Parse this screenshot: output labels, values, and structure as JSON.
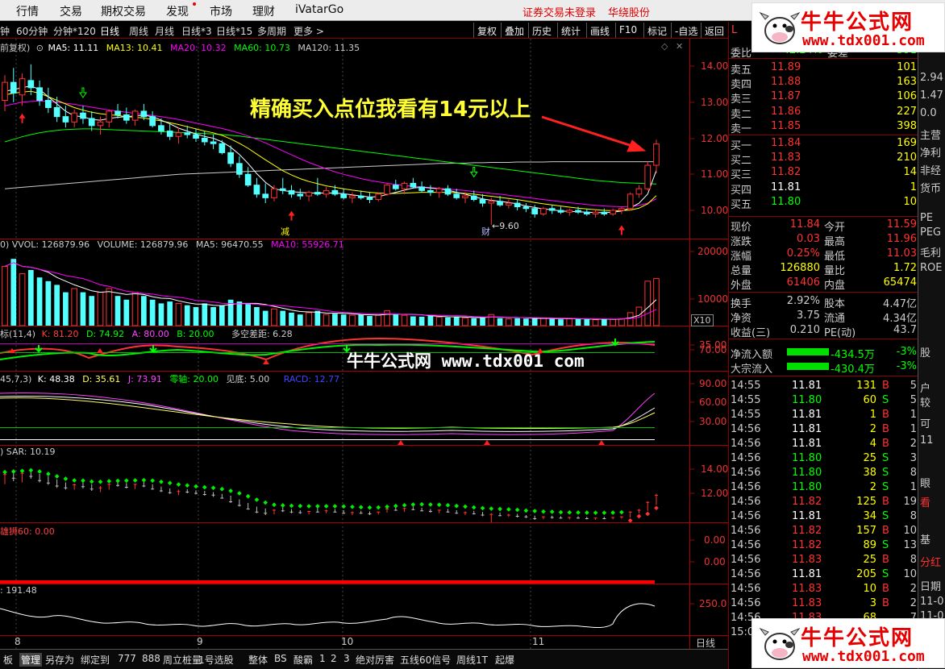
{
  "menubar": {
    "items": [
      "行情",
      "交易",
      "期权交易",
      "发现",
      "市场",
      "理财",
      "iVatarGo"
    ],
    "login_status": "证券交易未登录",
    "broker": "华绕股份"
  },
  "logo": {
    "name": "牛牛公式网",
    "url": "www.tdx001.com"
  },
  "period_toolbar": {
    "periods": [
      "钟",
      "60分钟",
      "分钟*120",
      "日线",
      "周线",
      "月线",
      "日线*3",
      "日线*15",
      "多周期",
      "更多 >"
    ],
    "active": "日线",
    "tools": [
      "复权",
      "叠加",
      "历史",
      "统计",
      "画线",
      "F10",
      "标记",
      "-自选",
      "返回"
    ]
  },
  "main_chart": {
    "fq": "前复权)",
    "ma5": "MA5: 11.11",
    "ma13": "MA13: 10.41",
    "ma20": "MA20: 10.32",
    "ma60": "MA60: 10.73",
    "ma120": "MA120: 11.35",
    "yticks": [
      "14.00",
      "13.00",
      "12.00",
      "11.00",
      "10.00"
    ],
    "annotation": "精确买入点位我看有14元以上",
    "low_label": "←9.60",
    "mark_jian": "减",
    "mark_cai": "财"
  },
  "vol_panel": {
    "label_vvol": "0)  VVOL: 126879.96",
    "label_volume": "VOLUME: 126879.96",
    "label_ma5": "MA5: 96470.55",
    "label_ma10": "MA10: 55926.71",
    "yticks": [
      "20000",
      "10000"
    ],
    "unit": "X10"
  },
  "kd_panel": {
    "label_name": "标(11,4)",
    "label_k": "K: 81.20",
    "label_d": "D: 74.92",
    "label_a": "A: 80.00",
    "label_b": "B: 20.00",
    "label_diff": "多空差距: 6.28",
    "yticks": [
      "70.00",
      "35.00"
    ],
    "watermark": "牛牛公式网 www.tdx001 com"
  },
  "kdj_panel": {
    "label_name": "45,7,3)",
    "label_k": "K: 48.38",
    "label_d": "D: 35.61",
    "label_j": "J: 73.91",
    "label_zero": "零轴: 20.00",
    "label_bottom": "见底: 5.00",
    "label_racd": "RACD: 12.77",
    "yticks": [
      "90.00",
      "60.00",
      "30.00"
    ]
  },
  "sar_panel": {
    "label": ")  SAR: 10.19",
    "yticks": [
      "14.00",
      "12.00"
    ]
  },
  "lion_panel": {
    "label": "雄狮60: 0.00",
    "yticks": [
      "0.00",
      "0.00"
    ]
  },
  "cci_panel": {
    "label": ": 191.48",
    "yticks": [
      "250.0"
    ]
  },
  "x_dates": [
    "8",
    "9",
    "10",
    "11",
    "日线"
  ],
  "bottom_tabs": [
    "板",
    "管理",
    "另存为",
    "绑定到",
    "777",
    "888",
    "周立桩量",
    "1号选股",
    "整体",
    "BS",
    "酸霸",
    "1",
    "2",
    "3",
    "绝对厉害",
    "五线60信号",
    "周线1T",
    "起爆"
  ],
  "bottom_tabs_active": "管理",
  "quote": {
    "header_left": "L",
    "weibi_label": "委比",
    "weibi_value": "-42.24%",
    "weicha_label": "委差",
    "weicha_value": "-591",
    "sell": [
      {
        "label": "卖五",
        "price": "11.89",
        "vol": "101"
      },
      {
        "label": "卖四",
        "price": "11.88",
        "vol": "163"
      },
      {
        "label": "卖三",
        "price": "11.87",
        "vol": "106"
      },
      {
        "label": "卖二",
        "price": "11.86",
        "vol": "227"
      },
      {
        "label": "卖一",
        "price": "11.85",
        "vol": "398"
      }
    ],
    "buy": [
      {
        "label": "买一",
        "price": "11.84",
        "vol": "169"
      },
      {
        "label": "买二",
        "price": "11.83",
        "vol": "210"
      },
      {
        "label": "买三",
        "price": "11.82",
        "vol": "14"
      },
      {
        "label": "买四",
        "price": "11.81",
        "vol": "1"
      },
      {
        "label": "买五",
        "price": "11.80",
        "vol": "10"
      }
    ],
    "stats": [
      {
        "l1": "现价",
        "v1": "11.84",
        "l2": "今开",
        "v2": "11.59"
      },
      {
        "l1": "涨跌",
        "v1": "0.03",
        "l2": "最高",
        "v2": "11.96"
      },
      {
        "l1": "涨幅",
        "v1": "0.25%",
        "l2": "最低",
        "v2": "11.03"
      },
      {
        "l1": "总量",
        "v1": "126880",
        "l2": "量比",
        "v2": "1.72"
      },
      {
        "l1": "外盘",
        "v1": "61406",
        "l2": "内盘",
        "v2": "65474"
      }
    ],
    "fin": [
      {
        "l1": "换手",
        "v1": "2.92%",
        "l2": "股本",
        "v2": "4.47亿"
      },
      {
        "l1": "净资",
        "v1": "3.75",
        "l2": "流通",
        "v2": "4.34亿"
      },
      {
        "l1": "收益(三)",
        "v1": "0.210",
        "l2": "PE(动)",
        "v2": "43.7"
      }
    ],
    "flow": [
      {
        "label": "净流入额",
        "value": "-434.5万",
        "pct": "-3%"
      },
      {
        "label": "大宗流入",
        "value": "-430.4万",
        "pct": "-3%"
      }
    ],
    "ticks": [
      {
        "t": "14:55",
        "p": "11.81",
        "v": "131",
        "d": "B",
        "n": "5"
      },
      {
        "t": "14:55",
        "p": "11.80",
        "v": "60",
        "d": "S",
        "n": "5"
      },
      {
        "t": "14:55",
        "p": "11.81",
        "v": "1",
        "d": "B",
        "n": "1"
      },
      {
        "t": "14:56",
        "p": "11.81",
        "v": "2",
        "d": "B",
        "n": "1"
      },
      {
        "t": "14:56",
        "p": "11.81",
        "v": "4",
        "d": "B",
        "n": "2"
      },
      {
        "t": "14:56",
        "p": "11.80",
        "v": "25",
        "d": "S",
        "n": "3"
      },
      {
        "t": "14:56",
        "p": "11.80",
        "v": "38",
        "d": "S",
        "n": "8"
      },
      {
        "t": "14:56",
        "p": "11.80",
        "v": "2",
        "d": "S",
        "n": "1"
      },
      {
        "t": "14:56",
        "p": "11.82",
        "v": "125",
        "d": "B",
        "n": "19"
      },
      {
        "t": "14:56",
        "p": "11.81",
        "v": "34",
        "d": "S",
        "n": "8"
      },
      {
        "t": "14:56",
        "p": "11.82",
        "v": "157",
        "d": "B",
        "n": "10"
      },
      {
        "t": "14:56",
        "p": "11.82",
        "v": "89",
        "d": "S",
        "n": "13"
      },
      {
        "t": "14:56",
        "p": "11.83",
        "v": "25",
        "d": "B",
        "n": "8"
      },
      {
        "t": "14:56",
        "p": "11.81",
        "v": "205",
        "d": "S",
        "n": "10"
      },
      {
        "t": "14:56",
        "p": "11.83",
        "v": "10",
        "d": "B",
        "n": "2"
      },
      {
        "t": "14:56",
        "p": "11.83",
        "v": "3",
        "d": "B",
        "n": "2"
      },
      {
        "t": "14:56",
        "p": "11.83",
        "v": "68",
        "d": "",
        "n": "7"
      }
    ],
    "time_bottom": "15:0"
  },
  "edge_panel": [
    "1",
    "2.94",
    "1.47",
    "0.0",
    "主营",
    "净利",
    "非经",
    "货币",
    "PE",
    "PEG",
    "毛利",
    "ROE",
    "股",
    "户",
    "较",
    "可",
    "11",
    "眼",
    "看",
    "基",
    "分红",
    "日期",
    "11-0",
    "11-0"
  ],
  "colors": {
    "up": "#ff3232",
    "down": "#54ffff",
    "ma5": "#ffffff",
    "ma13": "#ffff00",
    "ma20": "#ff00ff",
    "ma60": "#00ff00",
    "ma120": "#cccccc",
    "axis": "#aa0000"
  },
  "chart_data": {
    "type": "candlestick",
    "ylim": [
      9.6,
      14.2
    ],
    "ohlc": [
      [
        13.05,
        13.75,
        12.75,
        13.55
      ],
      [
        13.55,
        13.95,
        13.0,
        13.25
      ],
      [
        13.2,
        13.8,
        12.9,
        13.65
      ],
      [
        13.6,
        14.05,
        13.2,
        13.4
      ],
      [
        13.4,
        13.6,
        12.9,
        13.05
      ],
      [
        13.05,
        13.4,
        12.7,
        12.85
      ],
      [
        12.85,
        13.15,
        12.45,
        12.6
      ],
      [
        12.6,
        12.9,
        12.3,
        12.45
      ],
      [
        12.45,
        12.8,
        12.3,
        12.7
      ],
      [
        12.7,
        12.9,
        12.4,
        12.55
      ],
      [
        12.55,
        12.75,
        12.2,
        12.35
      ],
      [
        12.35,
        12.6,
        12.1,
        12.45
      ],
      [
        12.45,
        12.8,
        12.3,
        12.75
      ],
      [
        12.75,
        12.95,
        12.55,
        12.65
      ],
      [
        12.65,
        12.85,
        12.4,
        12.5
      ],
      [
        12.5,
        12.8,
        12.35,
        12.75
      ],
      [
        12.75,
        12.95,
        12.5,
        12.6
      ],
      [
        12.6,
        12.75,
        12.3,
        12.35
      ],
      [
        12.35,
        12.55,
        12.1,
        12.2
      ],
      [
        12.2,
        12.4,
        11.95,
        12.05
      ],
      [
        12.05,
        12.3,
        11.85,
        12.15
      ],
      [
        12.15,
        12.35,
        12.0,
        12.1
      ],
      [
        12.1,
        12.25,
        11.9,
        12.0
      ],
      [
        12.0,
        12.2,
        11.8,
        11.9
      ],
      [
        11.9,
        12.1,
        11.7,
        11.85
      ],
      [
        11.85,
        11.95,
        11.55,
        11.6
      ],
      [
        11.6,
        11.8,
        11.2,
        11.3
      ],
      [
        11.3,
        11.5,
        10.9,
        11.0
      ],
      [
        11.0,
        11.2,
        10.65,
        10.7
      ],
      [
        10.7,
        10.9,
        10.35,
        10.45
      ],
      [
        10.45,
        10.75,
        10.2,
        10.35
      ],
      [
        10.35,
        10.7,
        10.25,
        10.6
      ],
      [
        10.6,
        10.9,
        10.45,
        10.55
      ],
      [
        10.55,
        10.7,
        10.35,
        10.45
      ],
      [
        10.45,
        10.6,
        10.3,
        10.4
      ],
      [
        10.4,
        10.55,
        10.25,
        10.5
      ],
      [
        10.5,
        10.9,
        10.4,
        10.45
      ],
      [
        10.45,
        10.65,
        10.35,
        10.55
      ],
      [
        10.55,
        10.7,
        10.4,
        10.45
      ],
      [
        10.45,
        10.6,
        10.3,
        10.35
      ],
      [
        10.35,
        10.5,
        10.2,
        10.4
      ],
      [
        10.4,
        10.55,
        10.3,
        10.35
      ],
      [
        10.35,
        10.5,
        10.2,
        10.3
      ],
      [
        10.3,
        10.5,
        10.25,
        10.45
      ],
      [
        10.45,
        10.75,
        10.4,
        10.7
      ],
      [
        10.7,
        10.85,
        10.55,
        10.6
      ],
      [
        10.6,
        10.8,
        10.45,
        10.75
      ],
      [
        10.75,
        10.9,
        10.6,
        10.65
      ],
      [
        10.65,
        10.8,
        10.5,
        10.55
      ],
      [
        10.55,
        10.7,
        10.4,
        10.5
      ],
      [
        10.5,
        10.65,
        10.35,
        10.6
      ],
      [
        10.6,
        10.7,
        10.4,
        10.45
      ],
      [
        10.45,
        10.6,
        10.3,
        10.35
      ],
      [
        10.35,
        10.5,
        10.2,
        10.4
      ],
      [
        10.4,
        10.55,
        10.25,
        10.3
      ],
      [
        10.3,
        10.45,
        10.1,
        10.2
      ],
      [
        10.2,
        10.35,
        9.6,
        10.25
      ],
      [
        10.25,
        10.4,
        10.1,
        10.15
      ],
      [
        10.15,
        10.3,
        10.05,
        10.2
      ],
      [
        10.2,
        10.3,
        10.0,
        10.1
      ],
      [
        10.1,
        10.2,
        9.95,
        10.05
      ],
      [
        10.05,
        10.15,
        9.8,
        9.9
      ],
      [
        9.9,
        10.1,
        9.85,
        10.05
      ],
      [
        10.05,
        10.15,
        9.9,
        10.0
      ],
      [
        10.0,
        10.1,
        9.9,
        9.95
      ],
      [
        9.95,
        10.05,
        9.85,
        10.0
      ],
      [
        10.0,
        10.1,
        9.9,
        9.95
      ],
      [
        9.95,
        10.05,
        9.85,
        9.9
      ],
      [
        9.9,
        10.0,
        9.8,
        9.95
      ],
      [
        9.95,
        10.05,
        9.85,
        9.9
      ],
      [
        9.9,
        10.05,
        9.85,
        10.0
      ],
      [
        10.0,
        10.1,
        9.9,
        10.05
      ],
      [
        10.05,
        10.5,
        10.0,
        10.45
      ],
      [
        10.45,
        10.7,
        10.35,
        10.6
      ],
      [
        10.6,
        11.35,
        10.55,
        11.25
      ],
      [
        11.25,
        11.96,
        11.03,
        11.84
      ]
    ],
    "volume": [
      16000,
      18000,
      14000,
      15000,
      13000,
      12000,
      11000,
      9000,
      10000,
      9000,
      8000,
      9000,
      10000,
      8000,
      7000,
      9000,
      8000,
      7000,
      6000,
      6500,
      6000,
      5500,
      5000,
      6000,
      5000,
      5500,
      7000,
      6500,
      6000,
      5000,
      4000,
      4500,
      4000,
      3500,
      3000,
      3500,
      4000,
      3000,
      3200,
      3000,
      2800,
      3000,
      2600,
      2800,
      4000,
      3000,
      2800,
      2500,
      2400,
      2600,
      2300,
      2200,
      2400,
      2100,
      2000,
      2200,
      3000,
      2000,
      1800,
      2000,
      1900,
      2100,
      2000,
      1800,
      1700,
      1900,
      1800,
      1700,
      1600,
      1800,
      1700,
      1900,
      3500,
      5000,
      12000,
      12688
    ],
    "ma5": [
      13.3,
      13.35,
      13.4,
      13.45,
      13.35,
      13.15,
      12.95,
      12.75,
      12.62,
      12.6,
      12.52,
      12.5,
      12.55,
      12.58,
      12.6,
      12.62,
      12.64,
      12.6,
      12.5,
      12.4,
      12.28,
      12.2,
      12.12,
      12.05,
      12.0,
      11.9,
      11.75,
      11.55,
      11.3,
      11.02,
      10.78,
      10.6,
      10.55,
      10.52,
      10.5,
      10.48,
      10.48,
      10.48,
      10.48,
      10.46,
      10.43,
      10.4,
      10.37,
      10.38,
      10.44,
      10.5,
      10.56,
      10.62,
      10.64,
      10.62,
      10.6,
      10.56,
      10.5,
      10.45,
      10.38,
      10.32,
      10.28,
      10.25,
      10.22,
      10.18,
      10.12,
      10.08,
      10.04,
      10.02,
      9.98,
      9.97,
      9.96,
      9.95,
      9.94,
      9.94,
      9.95,
      9.98,
      10.07,
      10.2,
      10.45,
      11.11
    ],
    "ma13": [
      13.2,
      13.25,
      13.28,
      13.3,
      13.25,
      13.15,
      13.05,
      12.95,
      12.85,
      12.78,
      12.72,
      12.68,
      12.65,
      12.63,
      12.6,
      12.58,
      12.56,
      12.52,
      12.48,
      12.43,
      12.38,
      12.32,
      12.26,
      12.2,
      12.15,
      12.08,
      11.98,
      11.86,
      11.72,
      11.56,
      11.4,
      11.25,
      11.1,
      10.98,
      10.88,
      10.8,
      10.74,
      10.68,
      10.64,
      10.6,
      10.56,
      10.53,
      10.5,
      10.48,
      10.47,
      10.47,
      10.48,
      10.49,
      10.5,
      10.5,
      10.5,
      10.5,
      10.49,
      10.47,
      10.45,
      10.42,
      10.39,
      10.36,
      10.33,
      10.3,
      10.26,
      10.22,
      10.18,
      10.15,
      10.12,
      10.09,
      10.06,
      10.04,
      10.02,
      10.0,
      9.99,
      9.99,
      10.01,
      10.06,
      10.18,
      10.41
    ],
    "ma20": [
      12.9,
      12.95,
      13.0,
      13.02,
      13.03,
      13.02,
      13.0,
      12.97,
      12.94,
      12.9,
      12.86,
      12.82,
      12.78,
      12.75,
      12.72,
      12.69,
      12.66,
      12.63,
      12.6,
      12.56,
      12.52,
      12.47,
      12.42,
      12.37,
      12.32,
      12.27,
      12.21,
      12.14,
      12.06,
      11.97,
      11.87,
      11.76,
      11.65,
      11.54,
      11.43,
      11.33,
      11.24,
      11.15,
      11.07,
      11.0,
      10.94,
      10.88,
      10.83,
      10.79,
      10.75,
      10.72,
      10.69,
      10.67,
      10.65,
      10.63,
      10.61,
      10.59,
      10.57,
      10.55,
      10.52,
      10.5,
      10.47,
      10.45,
      10.42,
      10.39,
      10.36,
      10.33,
      10.3,
      10.27,
      10.24,
      10.21,
      10.19,
      10.16,
      10.14,
      10.12,
      10.11,
      10.1,
      10.11,
      10.14,
      10.2,
      10.32
    ],
    "ma60": [
      11.9,
      11.97,
      12.04,
      12.1,
      12.15,
      12.19,
      12.22,
      12.24,
      12.25,
      12.26,
      12.26,
      12.25,
      12.24,
      12.23,
      12.22,
      12.21,
      12.2,
      12.19,
      12.18,
      12.17,
      12.16,
      12.15,
      12.14,
      12.13,
      12.12,
      12.1,
      12.08,
      12.06,
      12.03,
      12.0,
      11.97,
      11.94,
      11.91,
      11.88,
      11.85,
      11.82,
      11.79,
      11.76,
      11.73,
      11.7,
      11.67,
      11.64,
      11.61,
      11.58,
      11.55,
      11.52,
      11.49,
      11.46,
      11.43,
      11.4,
      11.37,
      11.34,
      11.31,
      11.28,
      11.25,
      11.22,
      11.19,
      11.16,
      11.13,
      11.1,
      11.07,
      11.04,
      11.01,
      10.98,
      10.95,
      10.92,
      10.89,
      10.86,
      10.83,
      10.81,
      10.79,
      10.77,
      10.76,
      10.75,
      10.74,
      10.73
    ],
    "ma120": [
      10.6,
      10.62,
      10.64,
      10.66,
      10.68,
      10.7,
      10.72,
      10.74,
      10.76,
      10.78,
      10.8,
      10.82,
      10.84,
      10.86,
      10.88,
      10.9,
      10.92,
      10.94,
      10.96,
      10.98,
      11.0,
      11.01,
      11.02,
      11.03,
      11.04,
      11.05,
      11.06,
      11.07,
      11.08,
      11.09,
      11.1,
      11.11,
      11.12,
      11.13,
      11.14,
      11.15,
      11.16,
      11.17,
      11.18,
      11.19,
      11.2,
      11.21,
      11.22,
      11.23,
      11.24,
      11.25,
      11.26,
      11.27,
      11.28,
      11.29,
      11.3,
      11.3,
      11.31,
      11.31,
      11.32,
      11.32,
      11.33,
      11.33,
      11.33,
      11.34,
      11.34,
      11.34,
      11.34,
      11.35,
      11.35,
      11.35,
      11.35,
      11.35,
      11.35,
      11.35,
      11.35,
      11.35,
      11.35,
      11.35,
      11.35,
      11.35
    ]
  }
}
